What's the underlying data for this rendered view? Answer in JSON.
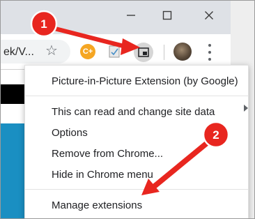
{
  "toolbar": {
    "url_fragment": "ek/V...",
    "coupon_ext_label": "C+"
  },
  "context_menu": {
    "title": "Picture-in-Picture Extension (by Google)",
    "site_data": "This can read and change site data",
    "options": "Options",
    "remove": "Remove from Chrome...",
    "hide": "Hide in Chrome menu",
    "manage": "Manage extensions"
  },
  "annotations": {
    "step1": "1",
    "step2": "2",
    "color": "#e8261f"
  }
}
